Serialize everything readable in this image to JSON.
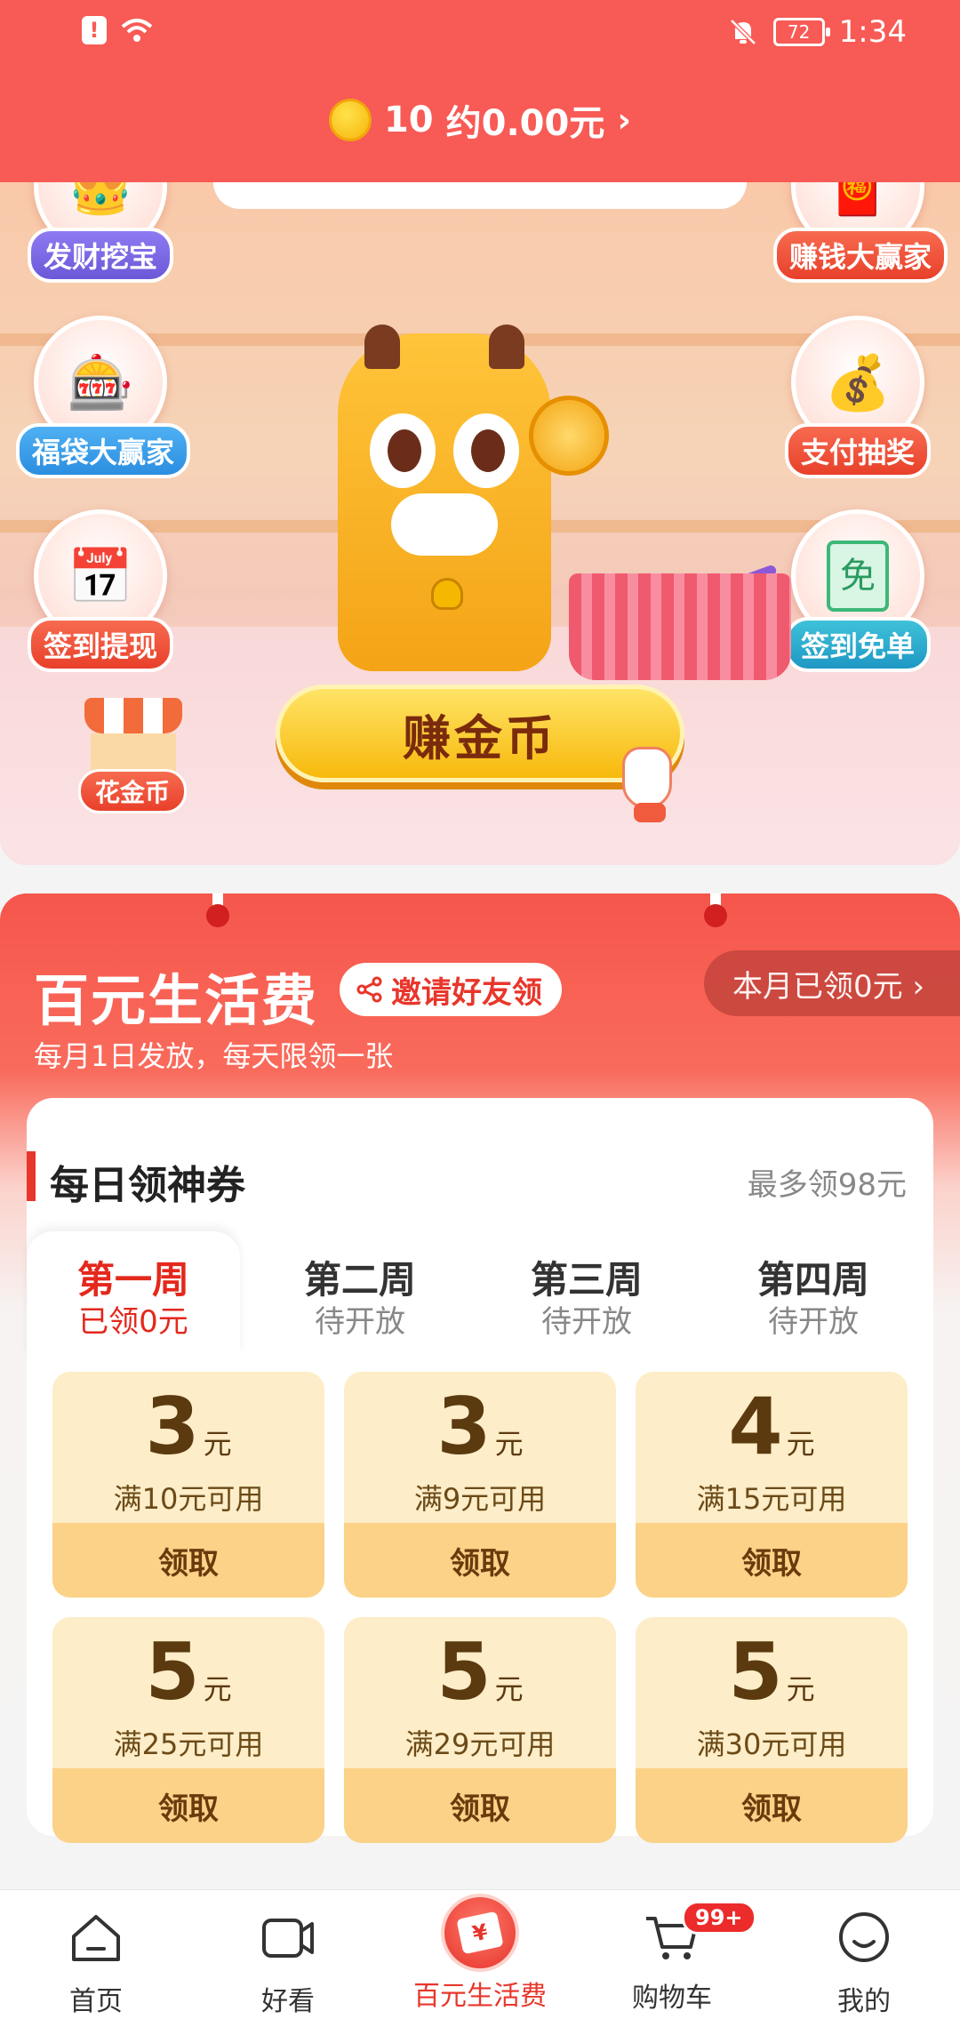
{
  "status_bar": {
    "battery": "72",
    "time": "1:34"
  },
  "coin_bar": {
    "count": "10",
    "value": "约0.00元",
    "arrow": "›"
  },
  "hero": {
    "features": [
      {
        "label": "发财挖宝",
        "icon": "crown-icon"
      },
      {
        "label": "福袋大赢家",
        "icon": "slot-machine-icon"
      },
      {
        "label": "签到提现",
        "icon": "calendar-wechat-icon"
      },
      {
        "label": "赚钱大赢家",
        "icon": "red-envelope-icon"
      },
      {
        "label": "支付抽奖",
        "icon": "lucky-bag-icon"
      },
      {
        "label": "签到免单",
        "icon": "free-ticket-icon"
      }
    ],
    "free_glyph": "免",
    "shop_label": "花金币",
    "earn_button": "赚金币"
  },
  "main": {
    "title": "百元生活费",
    "invite_button": "邀请好友领",
    "month_received": "本月已领0元 ›",
    "subtitle": "每月1日发放，每天限领一张",
    "coupon_section": {
      "title": "每日领神券",
      "max_text": "最多领98元",
      "weeks": [
        {
          "name": "第一周",
          "status": "已领0元",
          "active": true
        },
        {
          "name": "第二周",
          "status": "待开放",
          "active": false
        },
        {
          "name": "第三周",
          "status": "待开放",
          "active": false
        },
        {
          "name": "第四周",
          "status": "待开放",
          "active": false
        }
      ],
      "coupons": [
        {
          "amount": "3",
          "unit": "元",
          "condition": "满10元可用",
          "button": "领取"
        },
        {
          "amount": "3",
          "unit": "元",
          "condition": "满9元可用",
          "button": "领取"
        },
        {
          "amount": "4",
          "unit": "元",
          "condition": "满15元可用",
          "button": "领取"
        },
        {
          "amount": "5",
          "unit": "元",
          "condition": "满25元可用",
          "button": "领取"
        },
        {
          "amount": "5",
          "unit": "元",
          "condition": "满29元可用",
          "button": "领取"
        },
        {
          "amount": "5",
          "unit": "元",
          "condition": "满30元可用",
          "button": "领取"
        }
      ]
    }
  },
  "nav": {
    "items": [
      {
        "label": "首页",
        "icon": "home-icon"
      },
      {
        "label": "好看",
        "icon": "video-icon"
      },
      {
        "label": "百元生活费",
        "icon": "living-allowance-icon"
      },
      {
        "label": "购物车",
        "icon": "cart-icon",
        "badge": "99+"
      },
      {
        "label": "我的",
        "icon": "profile-icon"
      }
    ]
  },
  "colors": {
    "brand_red": "#f85a55",
    "accent_red": "#e8362b",
    "coupon_bg": "#fdedc8",
    "coupon_button": "#fbd288"
  }
}
